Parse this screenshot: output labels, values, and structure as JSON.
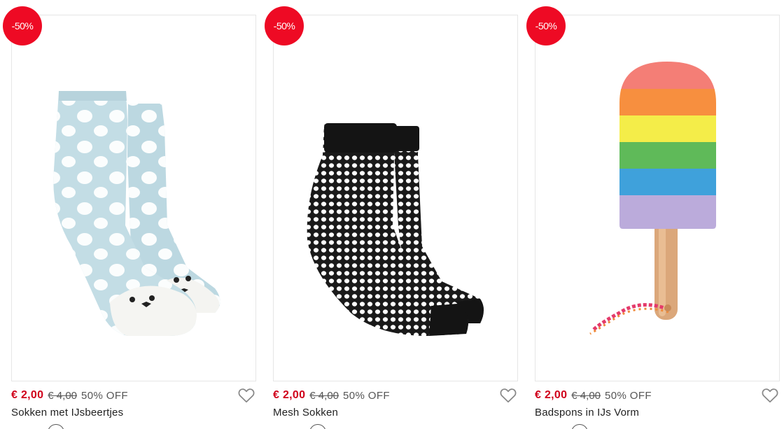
{
  "products": [
    {
      "badge": "-50%",
      "price_now": "€ 2,00",
      "price_old": "€ 4,00",
      "discount": "50% OFF",
      "name": "Sokken met IJsbeertjes",
      "image_icon": "polar-bear-socks-image"
    },
    {
      "badge": "-50%",
      "price_now": "€ 2,00",
      "price_old": "€ 4,00",
      "discount": "50% OFF",
      "name": "Mesh Sokken",
      "image_icon": "mesh-socks-image"
    },
    {
      "badge": "-50%",
      "price_now": "€ 2,00",
      "price_old": "€ 4,00",
      "discount": "50% OFF",
      "name": "Badspons in IJs Vorm",
      "image_icon": "popsicle-sponge-image"
    }
  ],
  "colors": {
    "badge": "#ee0a24",
    "price_now": "#d0021b",
    "border": "#e6e6e6"
  },
  "icons": {
    "wishlist": "heart-outline-icon"
  }
}
